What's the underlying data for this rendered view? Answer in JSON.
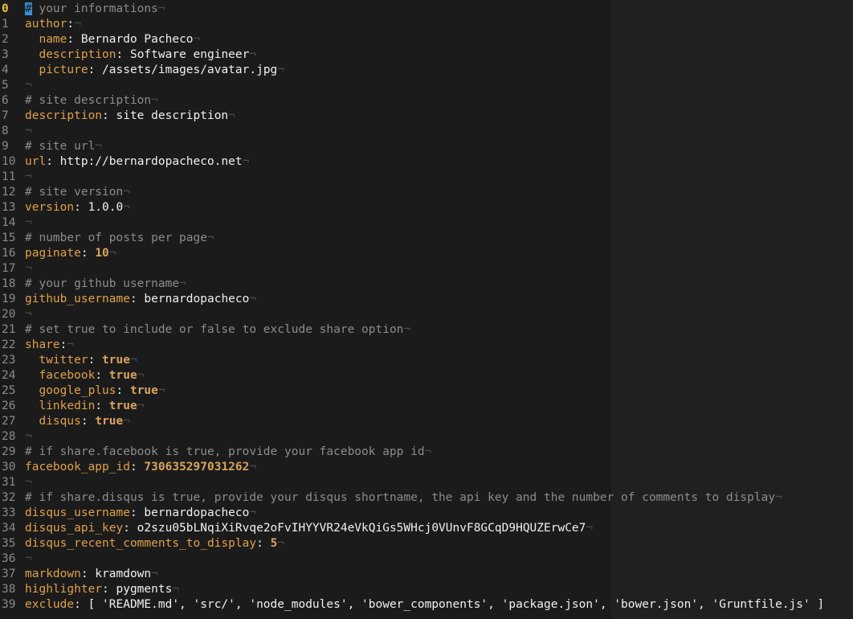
{
  "editor": {
    "eol_marker": "¬",
    "current_line": 0,
    "lines": [
      {
        "num": "0",
        "parts": [
          [
            "cursor",
            "#"
          ],
          [
            "comment",
            " your informations"
          ]
        ],
        "eol": true
      },
      {
        "num": "1",
        "parts": [
          [
            "key",
            "author"
          ],
          [
            "val",
            ":"
          ]
        ],
        "eol": true
      },
      {
        "num": "2",
        "parts": [
          [
            "val",
            "  "
          ],
          [
            "key",
            "name"
          ],
          [
            "val",
            ": Bernardo Pacheco"
          ]
        ],
        "eol": true
      },
      {
        "num": "3",
        "parts": [
          [
            "val",
            "  "
          ],
          [
            "key",
            "description"
          ],
          [
            "val",
            ": Software engineer"
          ]
        ],
        "eol": true
      },
      {
        "num": "4",
        "parts": [
          [
            "val",
            "  "
          ],
          [
            "key",
            "picture"
          ],
          [
            "val",
            ": /assets/images/avatar.jpg"
          ]
        ],
        "eol": true
      },
      {
        "num": "5",
        "parts": [],
        "eol": true
      },
      {
        "num": "6",
        "parts": [
          [
            "comment",
            "# site description"
          ]
        ],
        "eol": true
      },
      {
        "num": "7",
        "parts": [
          [
            "key",
            "description"
          ],
          [
            "val",
            ": site description"
          ]
        ],
        "eol": true
      },
      {
        "num": "8",
        "parts": [],
        "eol": true
      },
      {
        "num": "9",
        "parts": [
          [
            "comment",
            "# site url"
          ]
        ],
        "eol": true
      },
      {
        "num": "10",
        "parts": [
          [
            "key",
            "url"
          ],
          [
            "val",
            ": http://bernardopacheco.net"
          ]
        ],
        "eol": true
      },
      {
        "num": "11",
        "parts": [],
        "eol": true
      },
      {
        "num": "12",
        "parts": [
          [
            "comment",
            "# site version"
          ]
        ],
        "eol": true
      },
      {
        "num": "13",
        "parts": [
          [
            "key",
            "version"
          ],
          [
            "val",
            ": 1.0.0"
          ]
        ],
        "eol": true
      },
      {
        "num": "14",
        "parts": [],
        "eol": true
      },
      {
        "num": "15",
        "parts": [
          [
            "comment",
            "# number of posts per page"
          ]
        ],
        "eol": true
      },
      {
        "num": "16",
        "parts": [
          [
            "key",
            "paginate"
          ],
          [
            "val",
            ": "
          ],
          [
            "num",
            "10"
          ]
        ],
        "eol": true
      },
      {
        "num": "17",
        "parts": [],
        "eol": true
      },
      {
        "num": "18",
        "parts": [
          [
            "comment",
            "# your github username"
          ]
        ],
        "eol": true
      },
      {
        "num": "19",
        "parts": [
          [
            "key",
            "github_username"
          ],
          [
            "val",
            ": bernardopacheco"
          ]
        ],
        "eol": true
      },
      {
        "num": "20",
        "parts": [],
        "eol": true
      },
      {
        "num": "21",
        "parts": [
          [
            "comment",
            "# set true to include or false to exclude share option"
          ]
        ],
        "eol": true
      },
      {
        "num": "22",
        "parts": [
          [
            "key",
            "share"
          ],
          [
            "val",
            ":"
          ]
        ],
        "eol": true
      },
      {
        "num": "23",
        "parts": [
          [
            "val",
            "  "
          ],
          [
            "key",
            "twitter"
          ],
          [
            "val",
            ": "
          ],
          [
            "bool",
            "true"
          ]
        ],
        "eol": true
      },
      {
        "num": "24",
        "parts": [
          [
            "val",
            "  "
          ],
          [
            "key",
            "facebook"
          ],
          [
            "val",
            ": "
          ],
          [
            "bool",
            "true"
          ]
        ],
        "eol": true
      },
      {
        "num": "25",
        "parts": [
          [
            "val",
            "  "
          ],
          [
            "key",
            "google_plus"
          ],
          [
            "val",
            ": "
          ],
          [
            "bool",
            "true"
          ]
        ],
        "eol": true
      },
      {
        "num": "26",
        "parts": [
          [
            "val",
            "  "
          ],
          [
            "key",
            "linkedin"
          ],
          [
            "val",
            ": "
          ],
          [
            "bool",
            "true"
          ]
        ],
        "eol": true
      },
      {
        "num": "27",
        "parts": [
          [
            "val",
            "  "
          ],
          [
            "key",
            "disqus"
          ],
          [
            "val",
            ": "
          ],
          [
            "bool",
            "true"
          ]
        ],
        "eol": true
      },
      {
        "num": "28",
        "parts": [],
        "eol": true
      },
      {
        "num": "29",
        "parts": [
          [
            "comment",
            "# if share.facebook is true, provide your facebook app id"
          ]
        ],
        "eol": true
      },
      {
        "num": "30",
        "parts": [
          [
            "key",
            "facebook_app_id"
          ],
          [
            "val",
            ": "
          ],
          [
            "num",
            "730635297031262"
          ]
        ],
        "eol": true
      },
      {
        "num": "31",
        "parts": [],
        "eol": true
      },
      {
        "num": "32",
        "parts": [
          [
            "comment",
            "# if share.disqus is true, provide your disqus shortname, the api key and the number of comments to display"
          ]
        ],
        "eol": true
      },
      {
        "num": "33",
        "parts": [
          [
            "key",
            "disqus_username"
          ],
          [
            "val",
            ": bernardopacheco"
          ]
        ],
        "eol": true
      },
      {
        "num": "34",
        "parts": [
          [
            "key",
            "disqus_api_key"
          ],
          [
            "val",
            ": o2szu05bLNqiXiRvqe2oFvIHYYVR24eVkQiGs5WHcj0VUnvF8GCqD9HQUZErwCe7"
          ]
        ],
        "eol": true
      },
      {
        "num": "35",
        "parts": [
          [
            "key",
            "disqus_recent_comments_to_display"
          ],
          [
            "val",
            ": "
          ],
          [
            "num",
            "5"
          ]
        ],
        "eol": true
      },
      {
        "num": "36",
        "parts": [],
        "eol": true
      },
      {
        "num": "37",
        "parts": [
          [
            "key",
            "markdown"
          ],
          [
            "val",
            ": kramdown"
          ]
        ],
        "eol": true
      },
      {
        "num": "38",
        "parts": [
          [
            "key",
            "highlighter"
          ],
          [
            "val",
            ": pygments"
          ]
        ],
        "eol": true
      },
      {
        "num": "39",
        "parts": [
          [
            "key",
            "exclude"
          ],
          [
            "val",
            ": [ 'README.md', 'src/', 'node_modules', 'bower_components', 'package.json', 'bower.json', 'Gruntfile.js' ]"
          ]
        ],
        "eol": false
      }
    ]
  }
}
